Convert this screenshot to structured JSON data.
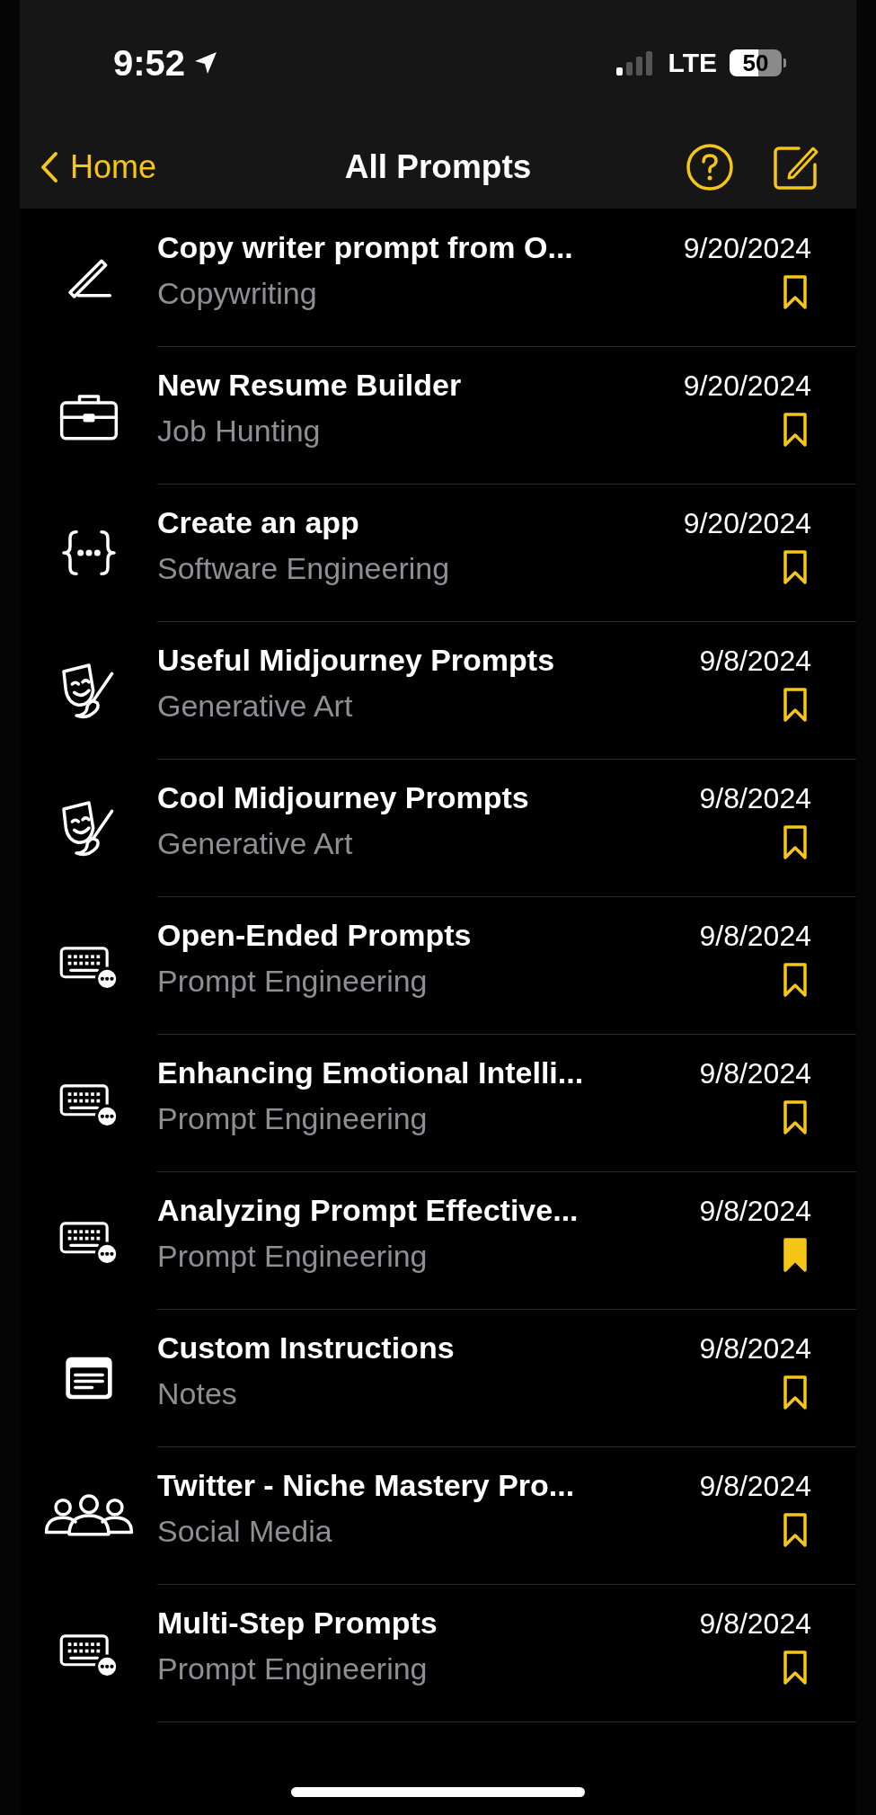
{
  "status_bar": {
    "time": "9:52",
    "network": "LTE",
    "battery": "50"
  },
  "nav": {
    "back": "Home",
    "title": "All Prompts"
  },
  "prompts": [
    {
      "kind": "writing",
      "title": "Copy writer prompt from O...",
      "category": "Copywriting",
      "date": "9/20/2024",
      "bookmarked": false
    },
    {
      "kind": "job",
      "title": "New Resume Builder",
      "category": "Job Hunting",
      "date": "9/20/2024",
      "bookmarked": false
    },
    {
      "kind": "code",
      "title": "Create an app",
      "category": "Software Engineering",
      "date": "9/20/2024",
      "bookmarked": false
    },
    {
      "kind": "art",
      "title": "Useful Midjourney Prompts",
      "category": "Generative Art",
      "date": "9/8/2024",
      "bookmarked": false
    },
    {
      "kind": "art",
      "title": "Cool Midjourney Prompts",
      "category": "Generative Art",
      "date": "9/8/2024",
      "bookmarked": false
    },
    {
      "kind": "prompt",
      "title": "Open-Ended Prompts",
      "category": "Prompt Engineering",
      "date": "9/8/2024",
      "bookmarked": false
    },
    {
      "kind": "prompt",
      "title": "Enhancing Emotional Intelli...",
      "category": "Prompt Engineering",
      "date": "9/8/2024",
      "bookmarked": false
    },
    {
      "kind": "prompt",
      "title": "Analyzing Prompt Effective...",
      "category": "Prompt Engineering",
      "date": "9/8/2024",
      "bookmarked": true
    },
    {
      "kind": "notes",
      "title": "Custom Instructions",
      "category": "Notes",
      "date": "9/8/2024",
      "bookmarked": false
    },
    {
      "kind": "social",
      "title": "Twitter - Niche Mastery Pro...",
      "category": "Social Media",
      "date": "9/8/2024",
      "bookmarked": false
    },
    {
      "kind": "prompt",
      "title": "Multi-Step Prompts",
      "category": "Prompt Engineering",
      "date": "9/8/2024",
      "bookmarked": false
    }
  ]
}
